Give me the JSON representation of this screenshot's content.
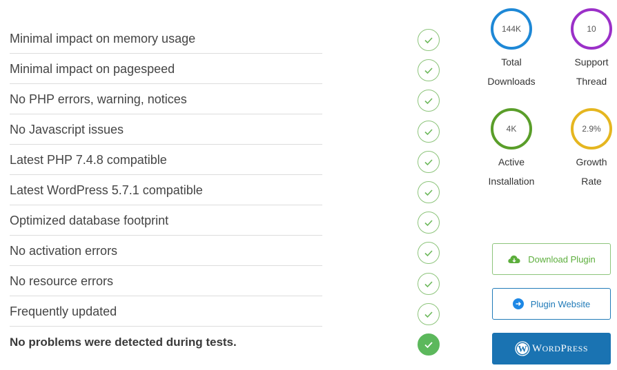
{
  "checklist": {
    "items": [
      {
        "label": "Minimal impact on memory usage",
        "status": "pass"
      },
      {
        "label": "Minimal impact on pagespeed",
        "status": "pass"
      },
      {
        "label": "No PHP errors, warning, notices",
        "status": "pass"
      },
      {
        "label": "No Javascript issues",
        "status": "pass"
      },
      {
        "label": "Latest PHP 7.4.8 compatible",
        "status": "pass"
      },
      {
        "label": "Latest WordPress 5.7.1 compatible",
        "status": "pass"
      },
      {
        "label": "Optimized database footprint",
        "status": "pass"
      },
      {
        "label": "No activation errors",
        "status": "pass"
      },
      {
        "label": "No resource errors",
        "status": "pass"
      },
      {
        "label": "Frequently updated",
        "status": "pass"
      }
    ],
    "summary": "No problems were detected during tests."
  },
  "stats": [
    {
      "value": "144K",
      "line1": "Total",
      "line2": "Downloads",
      "color": "#1e88d6"
    },
    {
      "value": "10",
      "line1": "Support",
      "line2": "Thread",
      "color": "#9b30c8"
    },
    {
      "value": "4K",
      "line1": "Active",
      "line2": "Installation",
      "color": "#5a9e2a"
    },
    {
      "value": "2.9%",
      "line1": "Growth",
      "line2": "Rate",
      "color": "#e5b620"
    }
  ],
  "buttons": {
    "download": {
      "label": "Download Plugin",
      "icon": "cloud-download-icon"
    },
    "website": {
      "label": "Plugin Website",
      "icon": "arrow-right-circle-icon"
    },
    "wordpress": {
      "label_big_w": "W",
      "label_rest": "ORD",
      "label_big_p": "P",
      "label_rest2": "RESS",
      "icon": "wordpress-logo-icon"
    }
  },
  "colors": {
    "check_green": "#8cc47a",
    "check_filled": "#5cb85c",
    "wordpress_blue": "#1a73b2"
  }
}
